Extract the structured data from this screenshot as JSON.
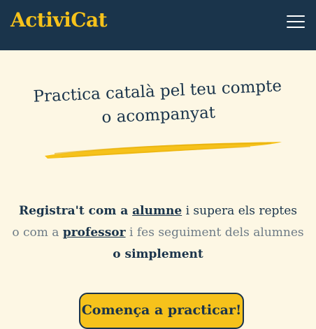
{
  "header": {
    "logo": "ActiviCat",
    "menu_icon": "hamburger-menu-icon"
  },
  "hero": {
    "title_line1": "Practica català pel teu compte",
    "title_line2": "o acompanyat"
  },
  "intro": {
    "l1_a": "Registra't com a ",
    "l1_link": "alumne",
    "l1_b": " i supera els reptes",
    "l2_a": "o com a ",
    "l2_link": "professor",
    "l2_b": " i fes seguiment dels alumnes",
    "l3": "o simplement"
  },
  "cta": {
    "label": "Comença a practicar!"
  },
  "colors": {
    "navy": "#1a344b",
    "yellow": "#f6c21b",
    "background": "#fdf7e4",
    "muted_text": "#6d7b86"
  }
}
